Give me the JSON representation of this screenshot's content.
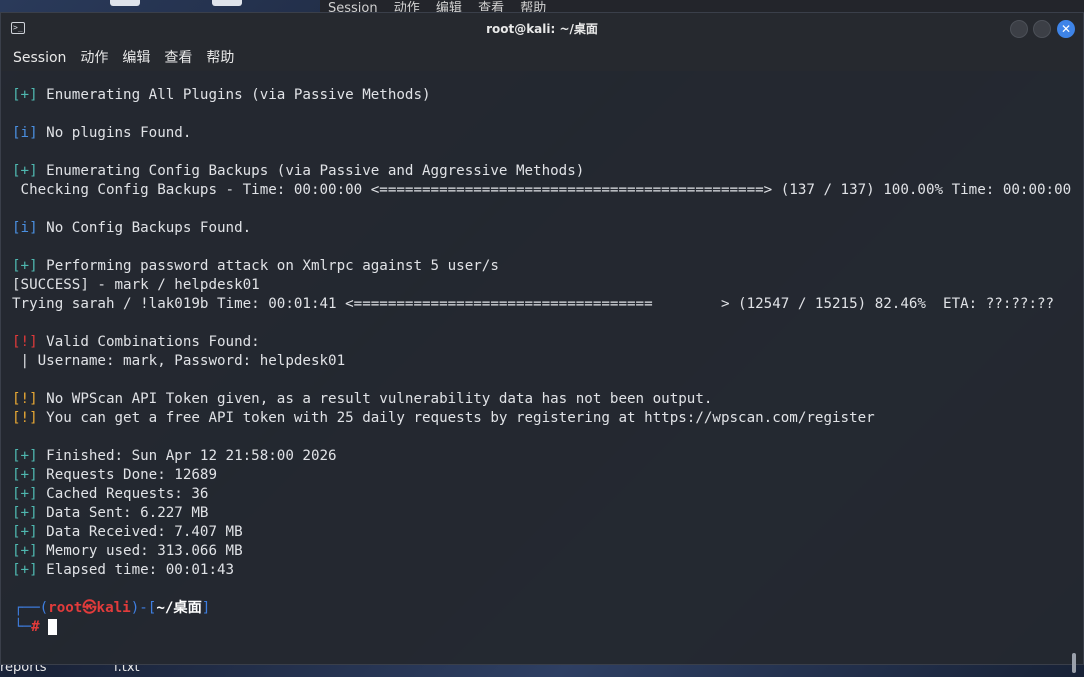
{
  "desktop": {
    "bg_menu": [
      "Session",
      "动作",
      "编辑",
      "查看",
      "帮助"
    ],
    "labels": [
      "reports",
      "l.txt"
    ]
  },
  "window": {
    "title": "root@kali: ~/桌面",
    "close_glyph": "✕"
  },
  "menubar": {
    "items": [
      "Session",
      "动作",
      "编辑",
      "查看",
      "帮助"
    ]
  },
  "terminal": {
    "lines": [
      {
        "tag": "[+]",
        "tag_class": "plus",
        "text": " Enumerating All Plugins (via Passive Methods)"
      },
      {
        "tag": "",
        "tag_class": "",
        "text": ""
      },
      {
        "tag": "[i]",
        "tag_class": "info",
        "text": " No plugins Found."
      },
      {
        "tag": "",
        "tag_class": "",
        "text": ""
      },
      {
        "tag": "[+]",
        "tag_class": "plus",
        "text": " Enumerating Config Backups (via Passive and Aggressive Methods)"
      },
      {
        "tag": "",
        "tag_class": "",
        "text": " Checking Config Backups - Time: 00:00:00 <=============================================> (137 / 137) 100.00% Time: 00:00:00"
      },
      {
        "tag": "",
        "tag_class": "",
        "text": ""
      },
      {
        "tag": "[i]",
        "tag_class": "info",
        "text": " No Config Backups Found."
      },
      {
        "tag": "",
        "tag_class": "",
        "text": ""
      },
      {
        "tag": "[+]",
        "tag_class": "plus",
        "text": " Performing password attack on Xmlrpc against 5 user/s"
      },
      {
        "tag": "",
        "tag_class": "",
        "text": "[SUCCESS] - mark / helpdesk01"
      },
      {
        "tag": "",
        "tag_class": "",
        "text": "Trying sarah / !lak019b Time: 00:01:41 <===================================        > (12547 / 15215) 82.46%  ETA: ??:??:??"
      },
      {
        "tag": "",
        "tag_class": "",
        "text": ""
      },
      {
        "tag": "[!]",
        "tag_class": "bang",
        "text": " Valid Combinations Found:"
      },
      {
        "tag": "",
        "tag_class": "",
        "text": " | Username: mark, Password: helpdesk01"
      },
      {
        "tag": "",
        "tag_class": "",
        "text": ""
      },
      {
        "tag": "[!]",
        "tag_class": "warn",
        "text": " No WPScan API Token given, as a result vulnerability data has not been output."
      },
      {
        "tag": "[!]",
        "tag_class": "warn",
        "text": " You can get a free API token with 25 daily requests by registering at https://wpscan.com/register"
      },
      {
        "tag": "",
        "tag_class": "",
        "text": ""
      },
      {
        "tag": "[+]",
        "tag_class": "plus",
        "text": " Finished: Sun Apr 12 21:58:00 2026"
      },
      {
        "tag": "[+]",
        "tag_class": "plus",
        "text": " Requests Done: 12689"
      },
      {
        "tag": "[+]",
        "tag_class": "plus",
        "text": " Cached Requests: 36"
      },
      {
        "tag": "[+]",
        "tag_class": "plus",
        "text": " Data Sent: 6.227 MB"
      },
      {
        "tag": "[+]",
        "tag_class": "plus",
        "text": " Data Received: 7.407 MB"
      },
      {
        "tag": "[+]",
        "tag_class": "plus",
        "text": " Memory used: 313.066 MB"
      },
      {
        "tag": "[+]",
        "tag_class": "plus",
        "text": " Elapsed time: 00:01:43"
      },
      {
        "tag": "",
        "tag_class": "",
        "text": ""
      }
    ],
    "prompt": {
      "corner_top": "┌──(",
      "user": "root㉿kali",
      "mid": ")-[",
      "path": "~/桌面",
      "end": "]",
      "corner_bottom": "└─",
      "hash": "#"
    }
  },
  "colors": {
    "plus": "#4fb8b0",
    "info": "#4a8fe0",
    "warn": "#e8a834",
    "bang": "#e03a3a",
    "prompt_blue": "#3e7ee0",
    "prompt_red": "#e23b3b",
    "close_button": "#3e84e8"
  }
}
